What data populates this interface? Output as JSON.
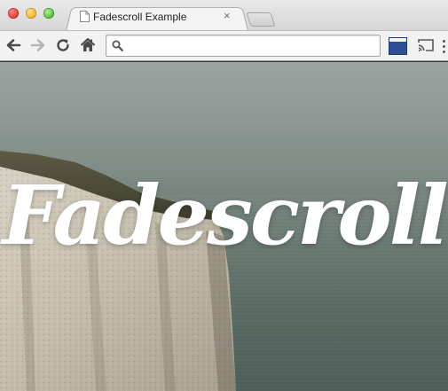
{
  "browser": {
    "tab": {
      "title": "Fadescroll Example",
      "close_glyph": "×"
    },
    "toolbar": {
      "back_icon": "back-arrow-icon",
      "forward_icon": "forward-arrow-icon",
      "reload_icon": "reload-icon",
      "home_icon": "home-icon",
      "address_value": "",
      "address_placeholder": ""
    },
    "extensions": {
      "extension_icon": "extension-icon",
      "cast_icon": "cast-icon",
      "menu_icon": "menu-icon"
    }
  },
  "page": {
    "hero_title": "Fadescroll"
  },
  "colors": {
    "extension_blue": "#2d4f93",
    "title_text": "#ffffff",
    "sky": "#9ca3a0",
    "sea": "#4c5e57",
    "cliff": "#c8c1b2"
  }
}
